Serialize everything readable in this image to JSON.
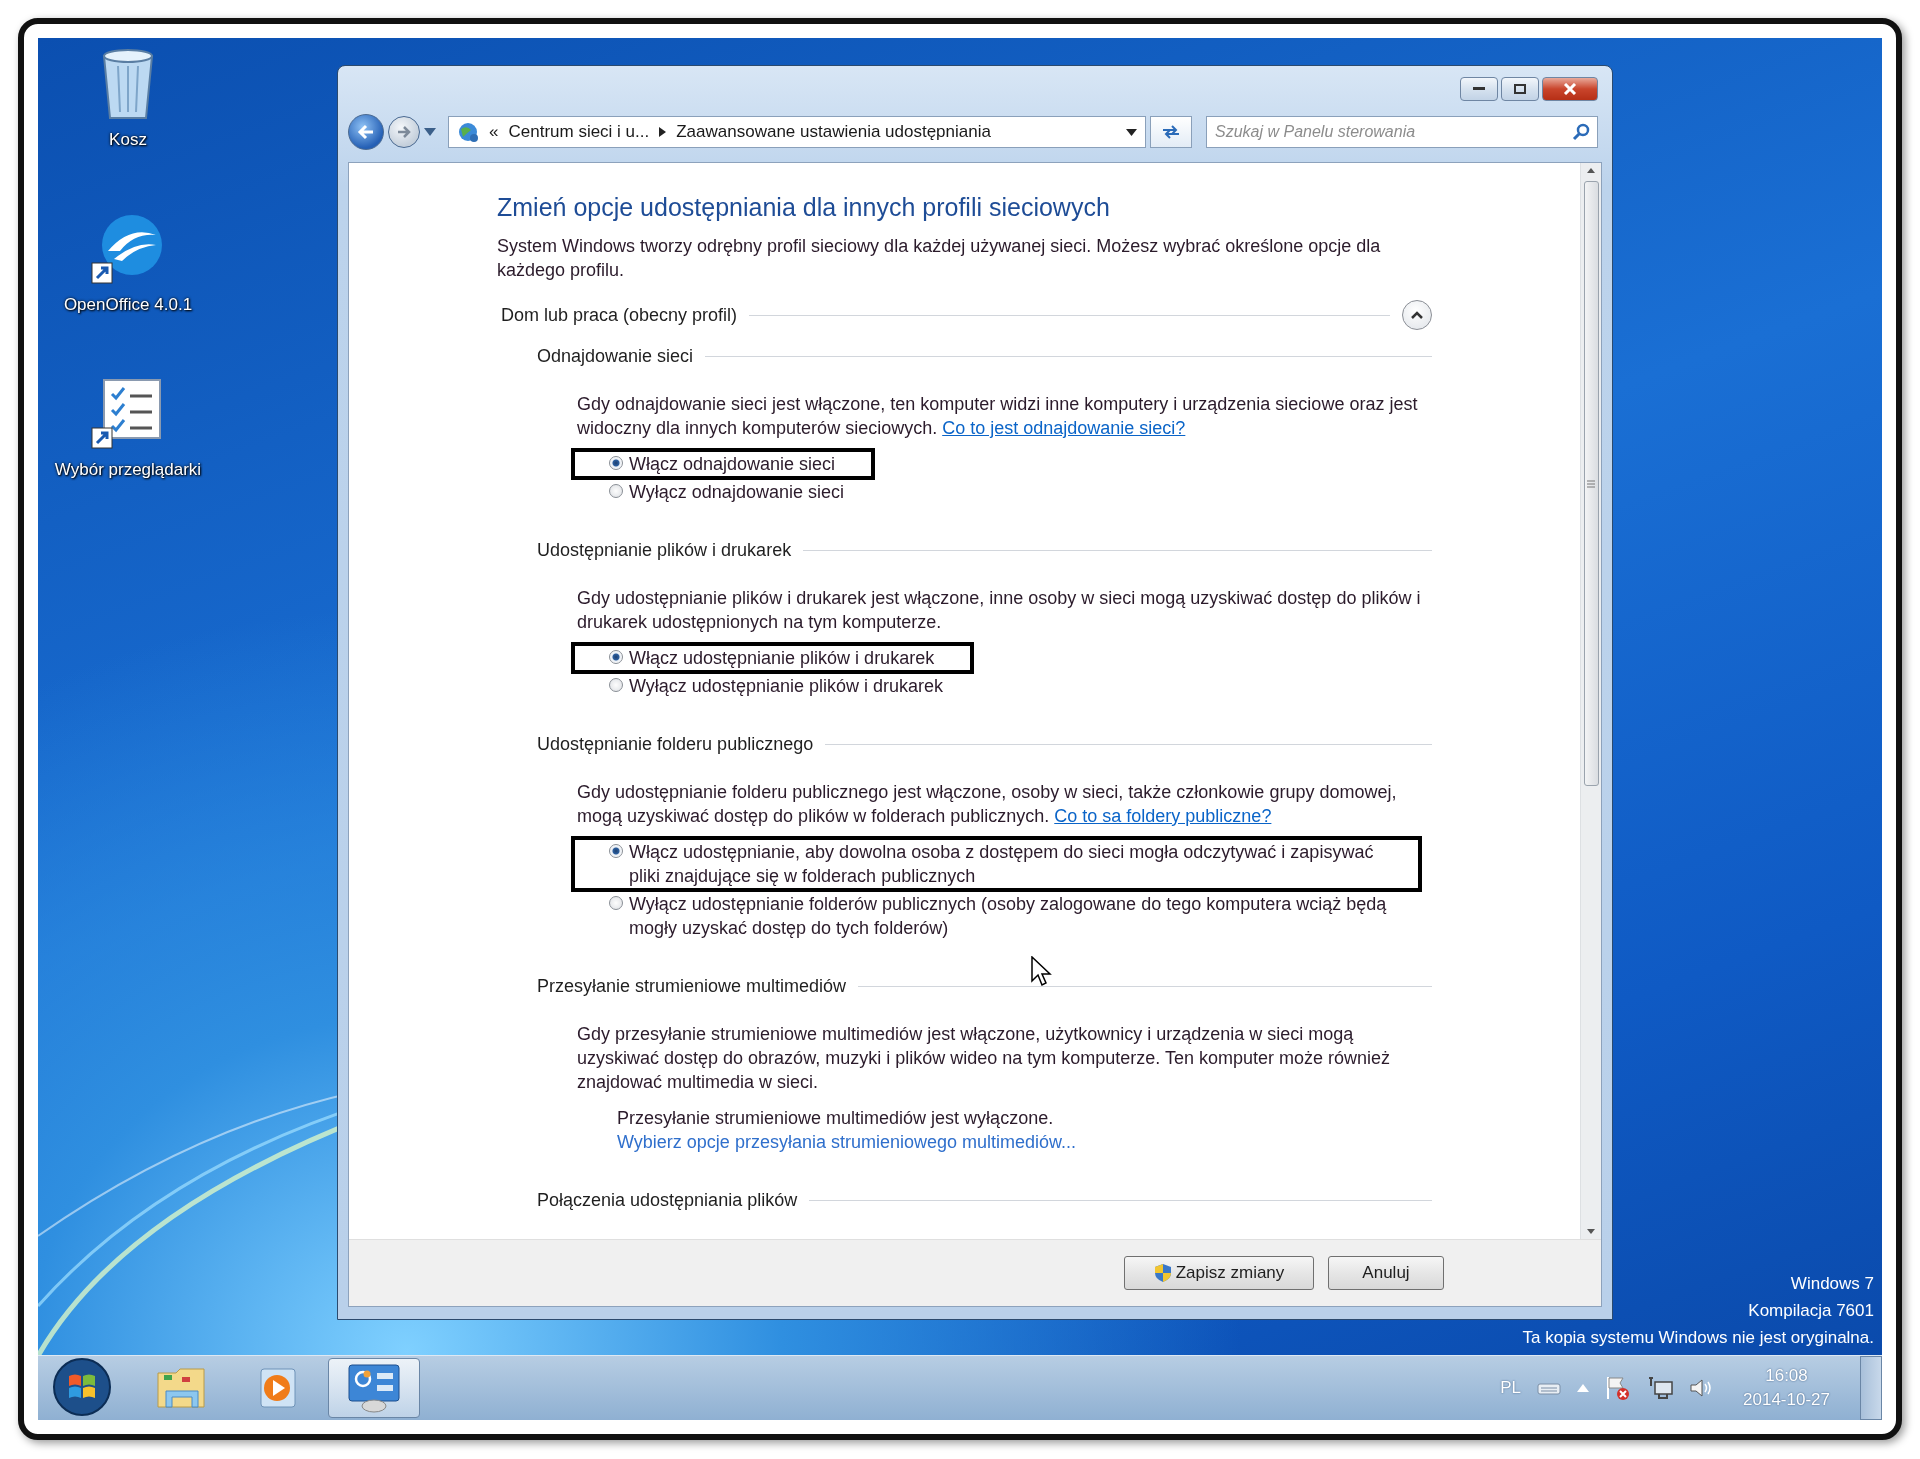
{
  "desktop_icons": [
    {
      "label": "Kosz",
      "kind": "bin"
    },
    {
      "label": "OpenOffice 4.0.1",
      "kind": "openoffice"
    },
    {
      "label": "Wybór przeglądarki",
      "kind": "checklist"
    }
  ],
  "window": {
    "address": {
      "prefix": "«",
      "crumbs": [
        "Centrum sieci i u...",
        "Zaawansowane ustawienia udostępniania"
      ]
    },
    "search": {
      "placeholder": "Szukaj w Panelu sterowania"
    },
    "heading": "Zmień opcje udostępniania dla innych profili sieciowych",
    "intro": "System Windows tworzy odrębny profil sieciowy dla każdej używanej sieci. Możesz wybrać określone opcje dla każdego profilu.",
    "profile": {
      "title": "Dom lub praca (obecny profil)",
      "expanded": true
    },
    "sections": [
      {
        "kind": "radio",
        "title": "Odnajdowanie sieci",
        "description": "Gdy odnajdowanie sieci jest włączone, ten komputer widzi inne komputery i urządzenia sieciowe oraz jest widoczny dla innych komputerów sieciowych.",
        "link": "Co to jest odnajdowanie sieci?",
        "options": [
          {
            "label": "Włącz odnajdowanie sieci",
            "selected": true,
            "outlined": true
          },
          {
            "label": "Wyłącz odnajdowanie sieci",
            "selected": false,
            "outlined": false
          }
        ]
      },
      {
        "kind": "radio",
        "title": "Udostępnianie plików i drukarek",
        "description": "Gdy udostępnianie plików i drukarek jest włączone, inne osoby w sieci mogą uzyskiwać dostęp do plików i drukarek udostępnionych na tym komputerze.",
        "options": [
          {
            "label": "Włącz udostępnianie plików i drukarek",
            "selected": true,
            "outlined": true
          },
          {
            "label": "Wyłącz udostępnianie plików i drukarek",
            "selected": false,
            "outlined": false
          }
        ]
      },
      {
        "kind": "radio",
        "title": "Udostępnianie folderu publicznego",
        "description": "Gdy udostępnianie folderu publicznego jest włączone, osoby w sieci, także członkowie grupy domowej, mogą uzyskiwać dostęp do plików w folderach publicznych.",
        "link": "Co to sa foldery publiczne?",
        "options": [
          {
            "label": "Włącz udostępnianie, aby dowolna osoba z dostępem do sieci mogła odczytywać i zapisywać pliki znajdujące się w folderach publicznych",
            "selected": true,
            "outlined": true
          },
          {
            "label": "Wyłącz udostępnianie folderów publicznych (osoby zalogowane do tego komputera wciąż będą mogły uzyskać dostęp do tych folderów)",
            "selected": false,
            "outlined": false
          }
        ]
      },
      {
        "kind": "info",
        "title": "Przesyłanie strumieniowe multimediów",
        "description": "Gdy przesyłanie strumieniowe multimediów jest włączone, użytkownicy i urządzenia w sieci mogą uzyskiwać dostęp do obrazów, muzyki i plików wideo na tym komputerze. Ten komputer może również znajdować multimedia w sieci.",
        "status": "Przesyłanie strumieniowe multimediów jest wyłączone.",
        "action": "Wybierz opcje przesyłania strumieniowego multimediów..."
      },
      {
        "kind": "heading",
        "title": "Połączenia udostępniania plików"
      }
    ],
    "buttons": [
      {
        "label": "Zapisz zmiany",
        "kind": "shield"
      },
      {
        "label": "Anuluj",
        "kind": "plain"
      }
    ]
  },
  "notice": [
    "Windows 7",
    "Kompilacja 7601",
    "Ta kopia systemu Windows nie jest oryginalna."
  ],
  "taskbar": {
    "items": [
      {
        "kind": "explorer",
        "selected": false
      },
      {
        "kind": "media",
        "selected": false
      },
      {
        "kind": "control-panel",
        "selected": true
      }
    ],
    "tray": {
      "language": "PL",
      "time": "16:08",
      "date": "2014-10-27"
    }
  }
}
